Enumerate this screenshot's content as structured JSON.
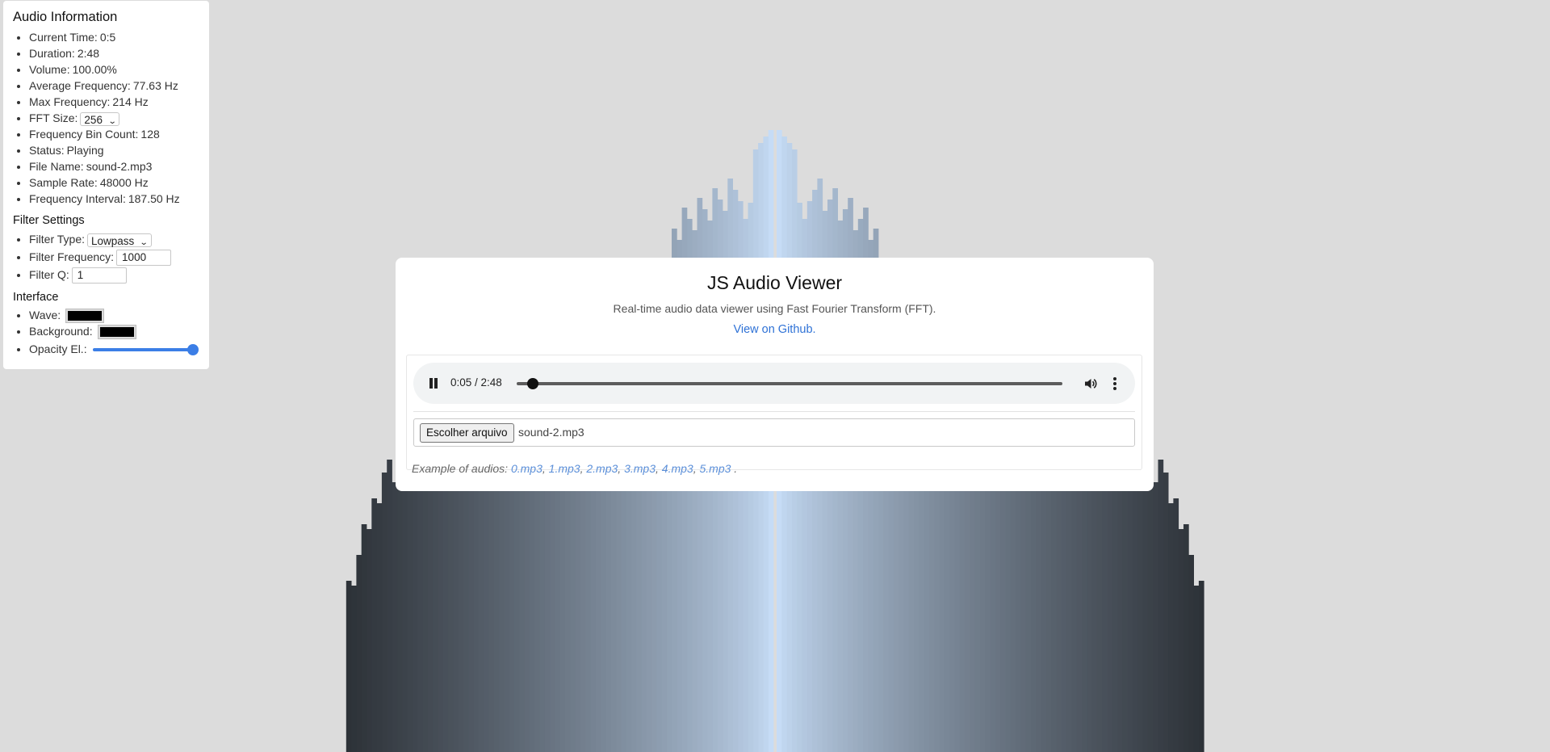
{
  "info": {
    "title": "Audio Information",
    "items": [
      {
        "label": "Current Time:",
        "value": "0:5"
      },
      {
        "label": "Duration:",
        "value": "2:48"
      },
      {
        "label": "Volume:",
        "value": "100.00%"
      },
      {
        "label": "Average Frequency:",
        "value": "77.63 Hz"
      },
      {
        "label": "Max Frequency:",
        "value": "214 Hz"
      }
    ],
    "fft_label": "FFT Size:",
    "fft_value": "256",
    "items2": [
      {
        "label": "Frequency Bin Count:",
        "value": "128"
      },
      {
        "label": "Status:",
        "value": "Playing"
      },
      {
        "label": "File Name:",
        "value": "sound-2.mp3"
      },
      {
        "label": "Sample Rate:",
        "value": "48000 Hz"
      },
      {
        "label": "Frequency Interval:",
        "value": "187.50 Hz"
      }
    ]
  },
  "filter": {
    "title": "Filter Settings",
    "type_label": "Filter Type:",
    "type_value": "Lowpass",
    "freq_label": "Filter Frequency:",
    "freq_value": "1000",
    "q_label": "Filter Q:",
    "q_value": "1"
  },
  "interface": {
    "title": "Interface",
    "wave_label": "Wave:",
    "wave_color": "#000000",
    "background_label": "Background:",
    "background_color": "#000000",
    "opacity_label": "Opacity El.:",
    "opacity_value": 1.0
  },
  "card": {
    "title": "JS Audio Viewer",
    "subtitle": "Real-time audio data viewer using Fast Fourier Transform (FFT).",
    "github_link": "View on Github."
  },
  "player": {
    "time": "0:05 / 2:48",
    "progress": 0.03,
    "state": "playing",
    "icons": [
      "pause-icon",
      "volume-icon",
      "more-vert-icon"
    ]
  },
  "file": {
    "button_label": "Escolher arquivo",
    "file_name": "sound-2.mp3"
  },
  "examples": {
    "prefix": "Example of audios: ",
    "links": [
      "0.mp3",
      "1.mp3",
      "2.mp3",
      "3.mp3",
      "4.mp3",
      "5.mp3"
    ],
    "suffix": " ."
  },
  "colors": {
    "page_background": "#dcdcdc",
    "accent": "#3b7ee6",
    "link": "#2f72d6",
    "bar_dark": "#2d3238",
    "bar_light": "#c6dcf6"
  }
}
